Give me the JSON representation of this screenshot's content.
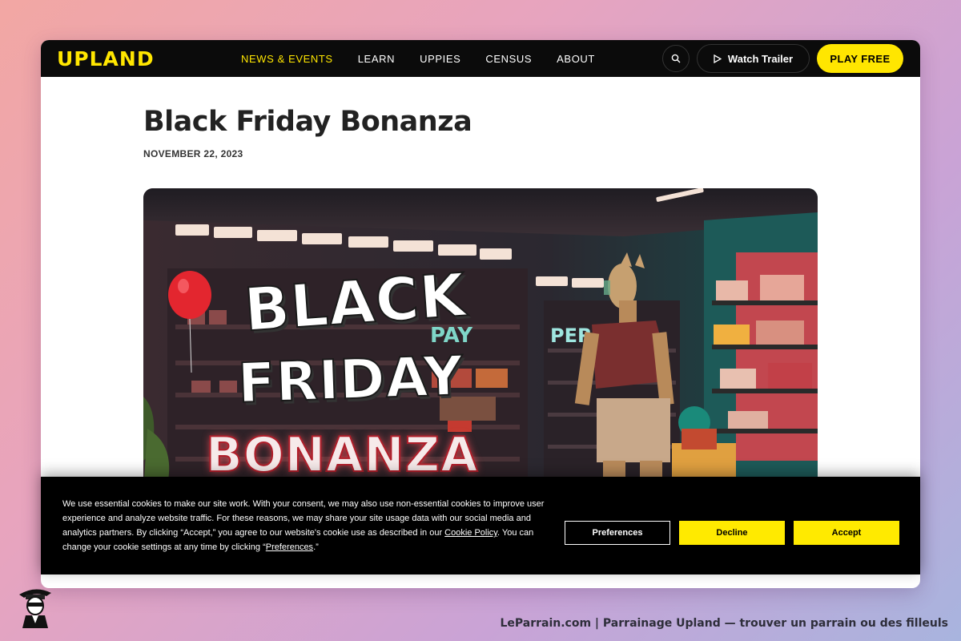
{
  "nav": {
    "logo": "UPLAND",
    "items": [
      {
        "label": "NEWS & EVENTS",
        "active": true
      },
      {
        "label": "LEARN",
        "active": false
      },
      {
        "label": "UPPIES",
        "active": false
      },
      {
        "label": "CENSUS",
        "active": false
      },
      {
        "label": "ABOUT",
        "active": false
      }
    ],
    "search_icon": "search-icon",
    "watch_trailer_label": "Watch Trailer",
    "play_free_label": "PLAY FREE"
  },
  "article": {
    "title": "Black Friday Bonanza",
    "date": "NOVEMBER 22, 2023",
    "hero": {
      "line1": "BLACK",
      "line2": "FRIDAY",
      "line3": "BONANZA",
      "sign_left": "PAY",
      "sign_right": "PER"
    }
  },
  "cookie": {
    "text_part1": "We use essential cookies to make our site work. With your consent, we may also use non-essential cookies to improve user experience and analyze website traffic. For these reasons, we may share your site usage data with our social media and analytics partners. By clicking “Accept,” you agree to our website's cookie use as described in our ",
    "policy_link": "Cookie Policy",
    "text_part2": ". You can change your cookie settings at any time by clicking “",
    "preferences_link": "Preferences",
    "text_part3": ".”",
    "preferences_label": "Preferences",
    "decline_label": "Decline",
    "accept_label": "Accept"
  },
  "footer": {
    "note": "LeParrain.com | Parrainage Upland — trouver un parrain ou des filleuls"
  },
  "colors": {
    "accent": "#ffe600",
    "nav_bg": "#0b0b0b",
    "cookie_bg": "#000000"
  }
}
